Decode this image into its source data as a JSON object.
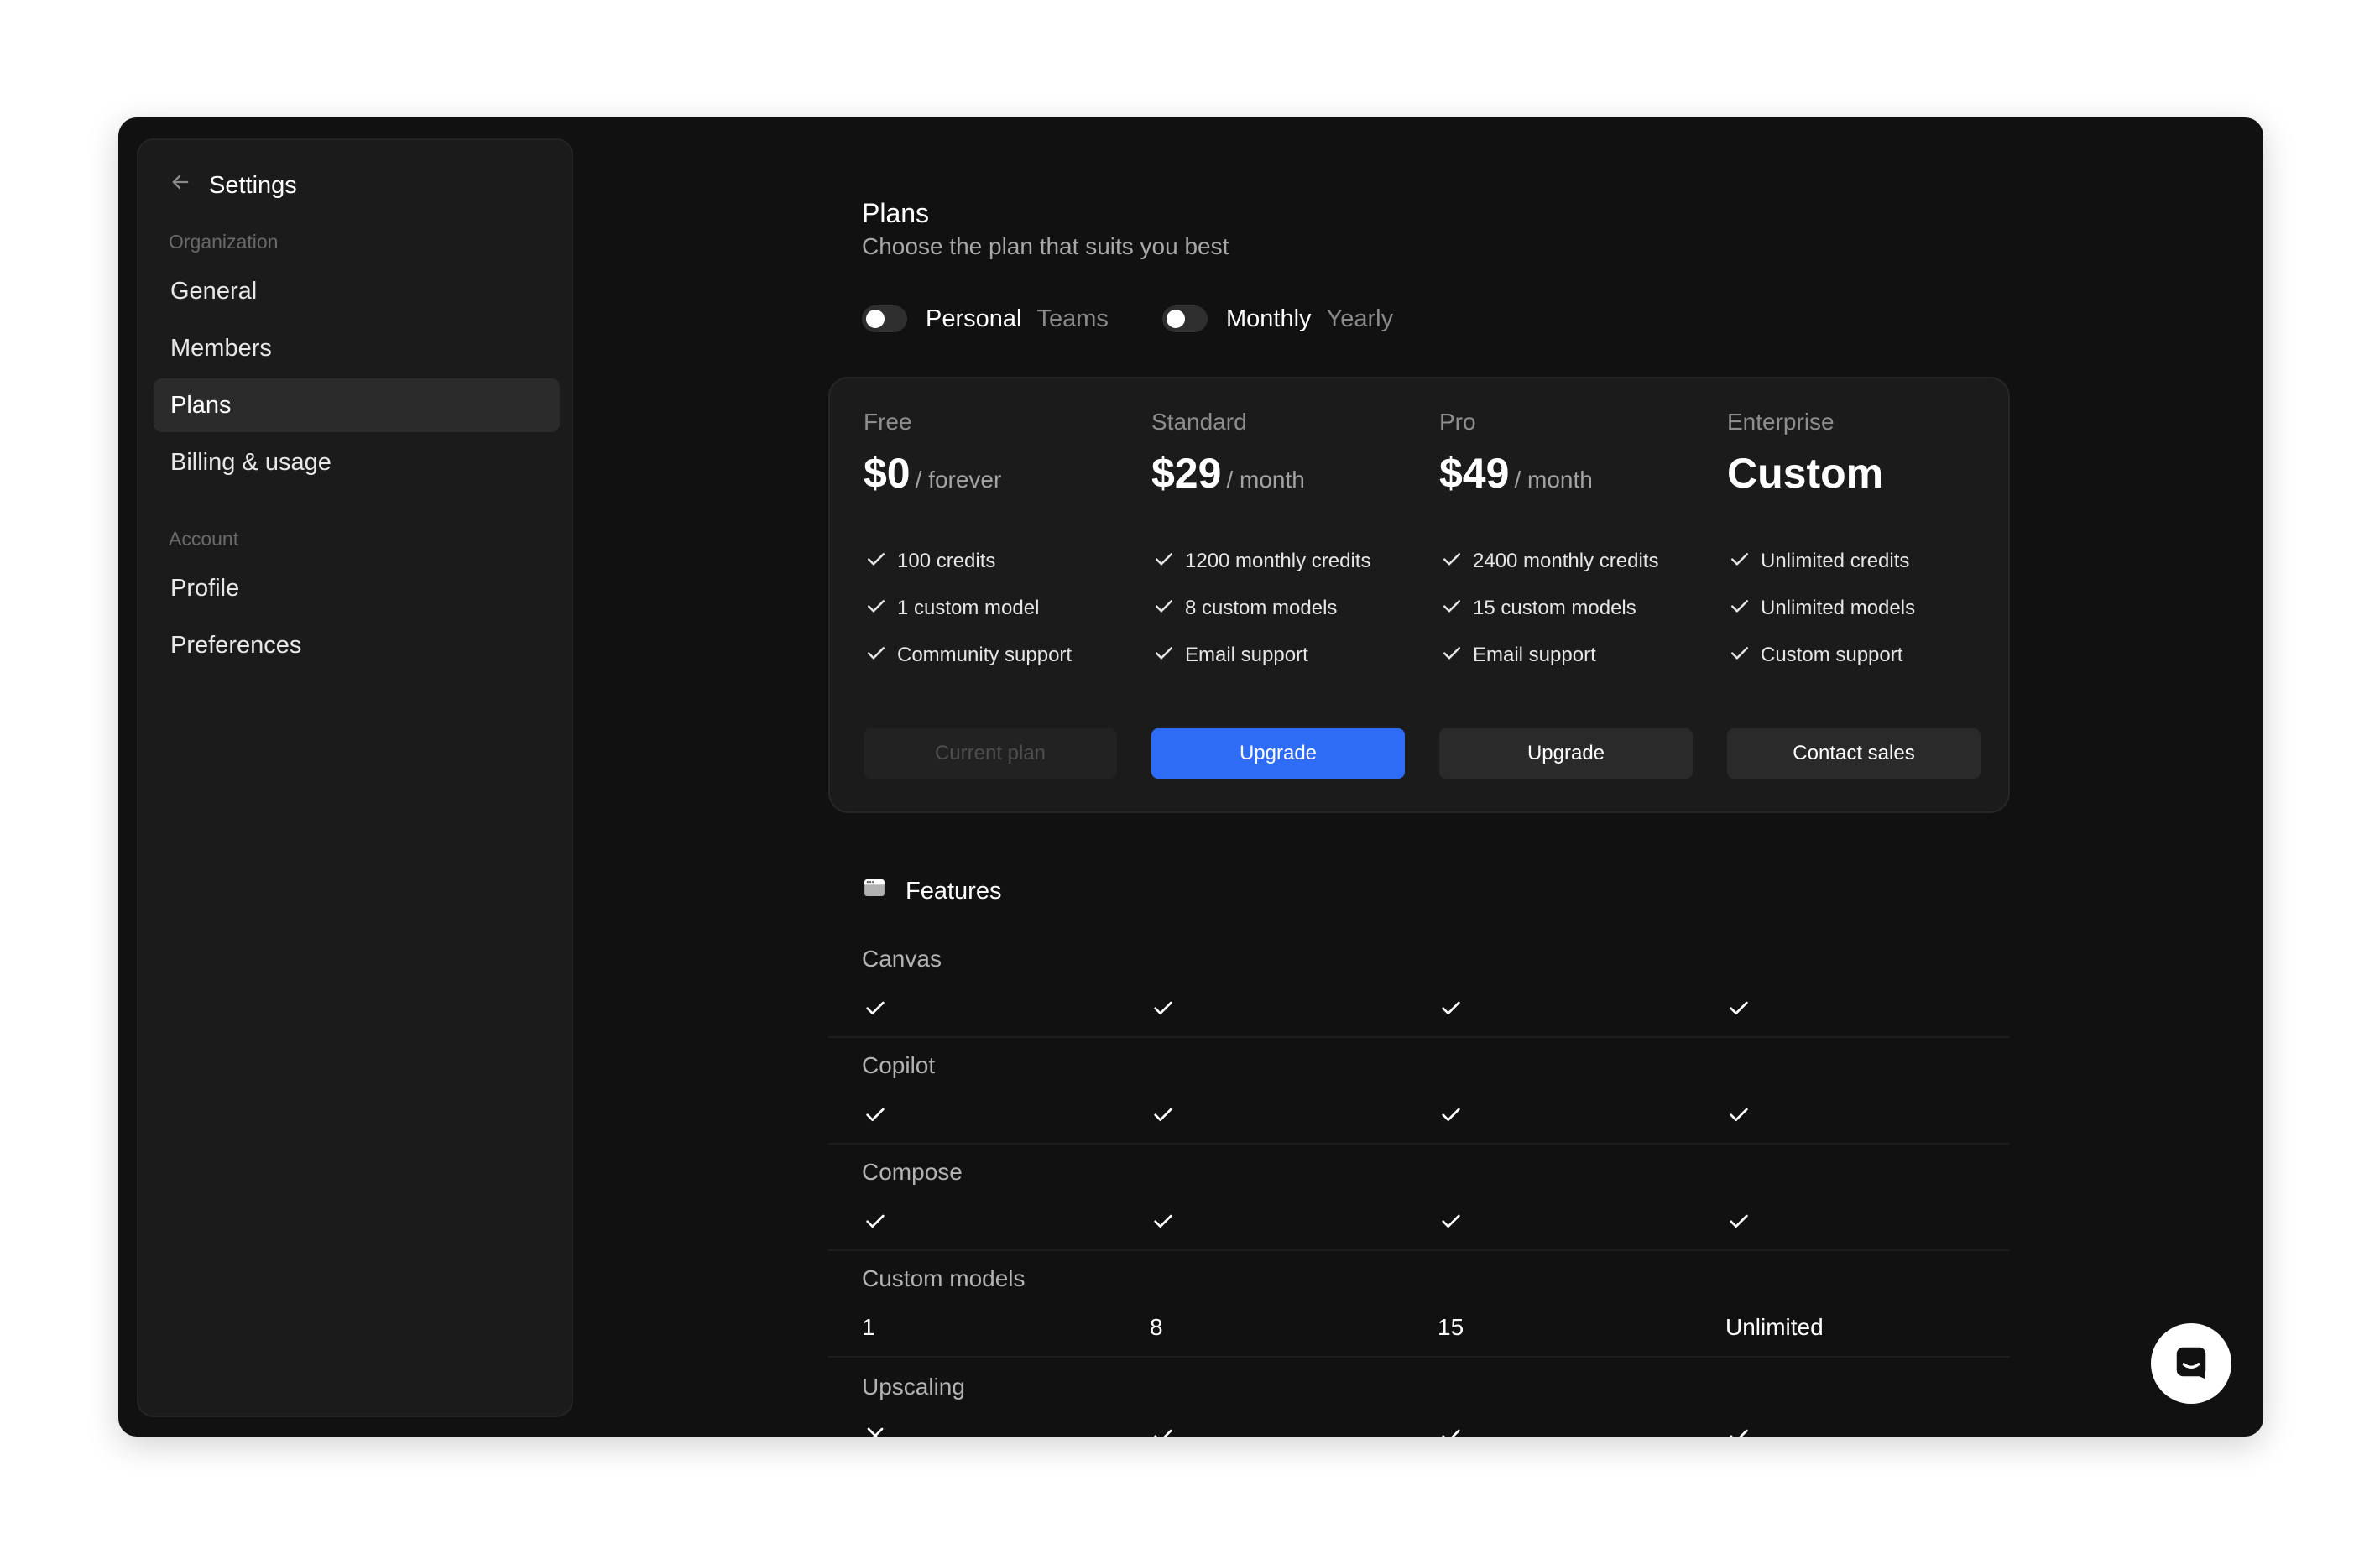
{
  "sidebar": {
    "header": "Settings",
    "sections": [
      {
        "label": "Organization",
        "items": [
          {
            "label": "General",
            "active": false
          },
          {
            "label": "Members",
            "active": false
          },
          {
            "label": "Plans",
            "active": true
          },
          {
            "label": "Billing & usage",
            "active": false
          }
        ]
      },
      {
        "label": "Account",
        "items": [
          {
            "label": "Profile",
            "active": false
          },
          {
            "label": "Preferences",
            "active": false
          }
        ]
      }
    ]
  },
  "main": {
    "title": "Plans",
    "subtitle": "Choose the plan that suits you best",
    "toggles": [
      {
        "on": "Personal",
        "off": "Teams"
      },
      {
        "on": "Monthly",
        "off": "Yearly"
      }
    ],
    "plans": [
      {
        "name": "Free",
        "price": "$0",
        "period": "/ forever",
        "features": [
          "100 credits",
          "1 custom model",
          "Community support"
        ],
        "button": "Current plan",
        "button_style": "disabled"
      },
      {
        "name": "Standard",
        "price": "$29",
        "period": "/ month",
        "features": [
          "1200 monthly credits",
          "8 custom models",
          "Email support"
        ],
        "button": "Upgrade",
        "button_style": "primary"
      },
      {
        "name": "Pro",
        "price": "$49",
        "period": "/ month",
        "features": [
          "2400 monthly credits",
          "15 custom models",
          "Email support"
        ],
        "button": "Upgrade",
        "button_style": "secondary"
      },
      {
        "name": "Enterprise",
        "price": "Custom",
        "period": "",
        "features": [
          "Unlimited credits",
          "Unlimited models",
          "Custom support"
        ],
        "button": "Contact sales",
        "button_style": "secondary"
      }
    ],
    "features_title": "Features",
    "feature_rows": [
      {
        "label": "Canvas",
        "values": [
          "check",
          "check",
          "check",
          "check"
        ]
      },
      {
        "label": "Copilot",
        "values": [
          "check",
          "check",
          "check",
          "check"
        ]
      },
      {
        "label": "Compose",
        "values": [
          "check",
          "check",
          "check",
          "check"
        ]
      },
      {
        "label": "Custom models",
        "values": [
          "1",
          "8",
          "15",
          "Unlimited"
        ]
      },
      {
        "label": "Upscaling",
        "values": [
          "cross",
          "check",
          "check",
          "check"
        ]
      }
    ]
  },
  "icons": {
    "back": "arrow-left-icon",
    "check": "check-icon",
    "cross": "x-icon",
    "features": "window-icon",
    "chat": "chat-icon"
  },
  "colors": {
    "accent": "#2f6cf6",
    "background": "#111111",
    "panel": "#1b1b1b"
  }
}
